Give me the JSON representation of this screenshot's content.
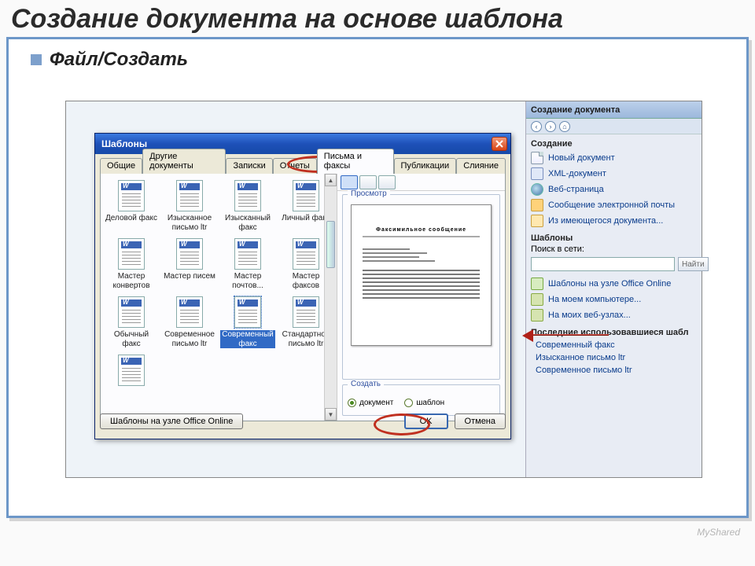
{
  "slide": {
    "title": "Создание документа на основе шаблона",
    "bullet": "Файл/Создать"
  },
  "taskpane": {
    "title": "Создание документа",
    "nav": {
      "back": "‹",
      "fwd": "›",
      "home": "⌂"
    },
    "create_heading": "Создание",
    "items_create": [
      "Новый документ",
      "XML-документ",
      "Веб-страница",
      "Сообщение электронной почты",
      "Из имеющегося документа..."
    ],
    "templates_heading": "Шаблоны",
    "search_label": "Поиск в сети:",
    "search_button": "Найти",
    "items_templates": [
      "Шаблоны на узле Office Online",
      "На моем компьютере...",
      "На моих веб-узлах..."
    ],
    "recent_heading": "Последние использовавшиеся шабл",
    "recent_items": [
      "Современный факс",
      "Изысканное письмо ltr",
      "Современное письмо ltr"
    ]
  },
  "dialog": {
    "title": "Шаблоны",
    "tabs": [
      "Общие",
      "Другие документы",
      "Записки",
      "Отчеты",
      "Письма и факсы",
      "Публикации",
      "Слияние"
    ],
    "active_tab": "Письма и факсы",
    "templates": [
      "Деловой факс",
      "Изысканное письмо ltr",
      "Изысканный факс",
      "Личный факс",
      "Мастер конвертов",
      "Мастер писем",
      "Мастер почтов...",
      "Мастер факсов",
      "Обычный факс",
      "Современное письмо ltr",
      "Современный факс",
      "Стандартное письмо ltr",
      ""
    ],
    "selected_template": "Современный факс",
    "preview_label": "Просмотр",
    "preview_title": "Факсимильное сообщение",
    "create_label": "Создать",
    "radio_document": "документ",
    "radio_template": "шаблон",
    "ok": "OK",
    "cancel": "Отмена",
    "office_online_btn": "Шаблоны на узле Office Online"
  },
  "watermark": "MyShared"
}
